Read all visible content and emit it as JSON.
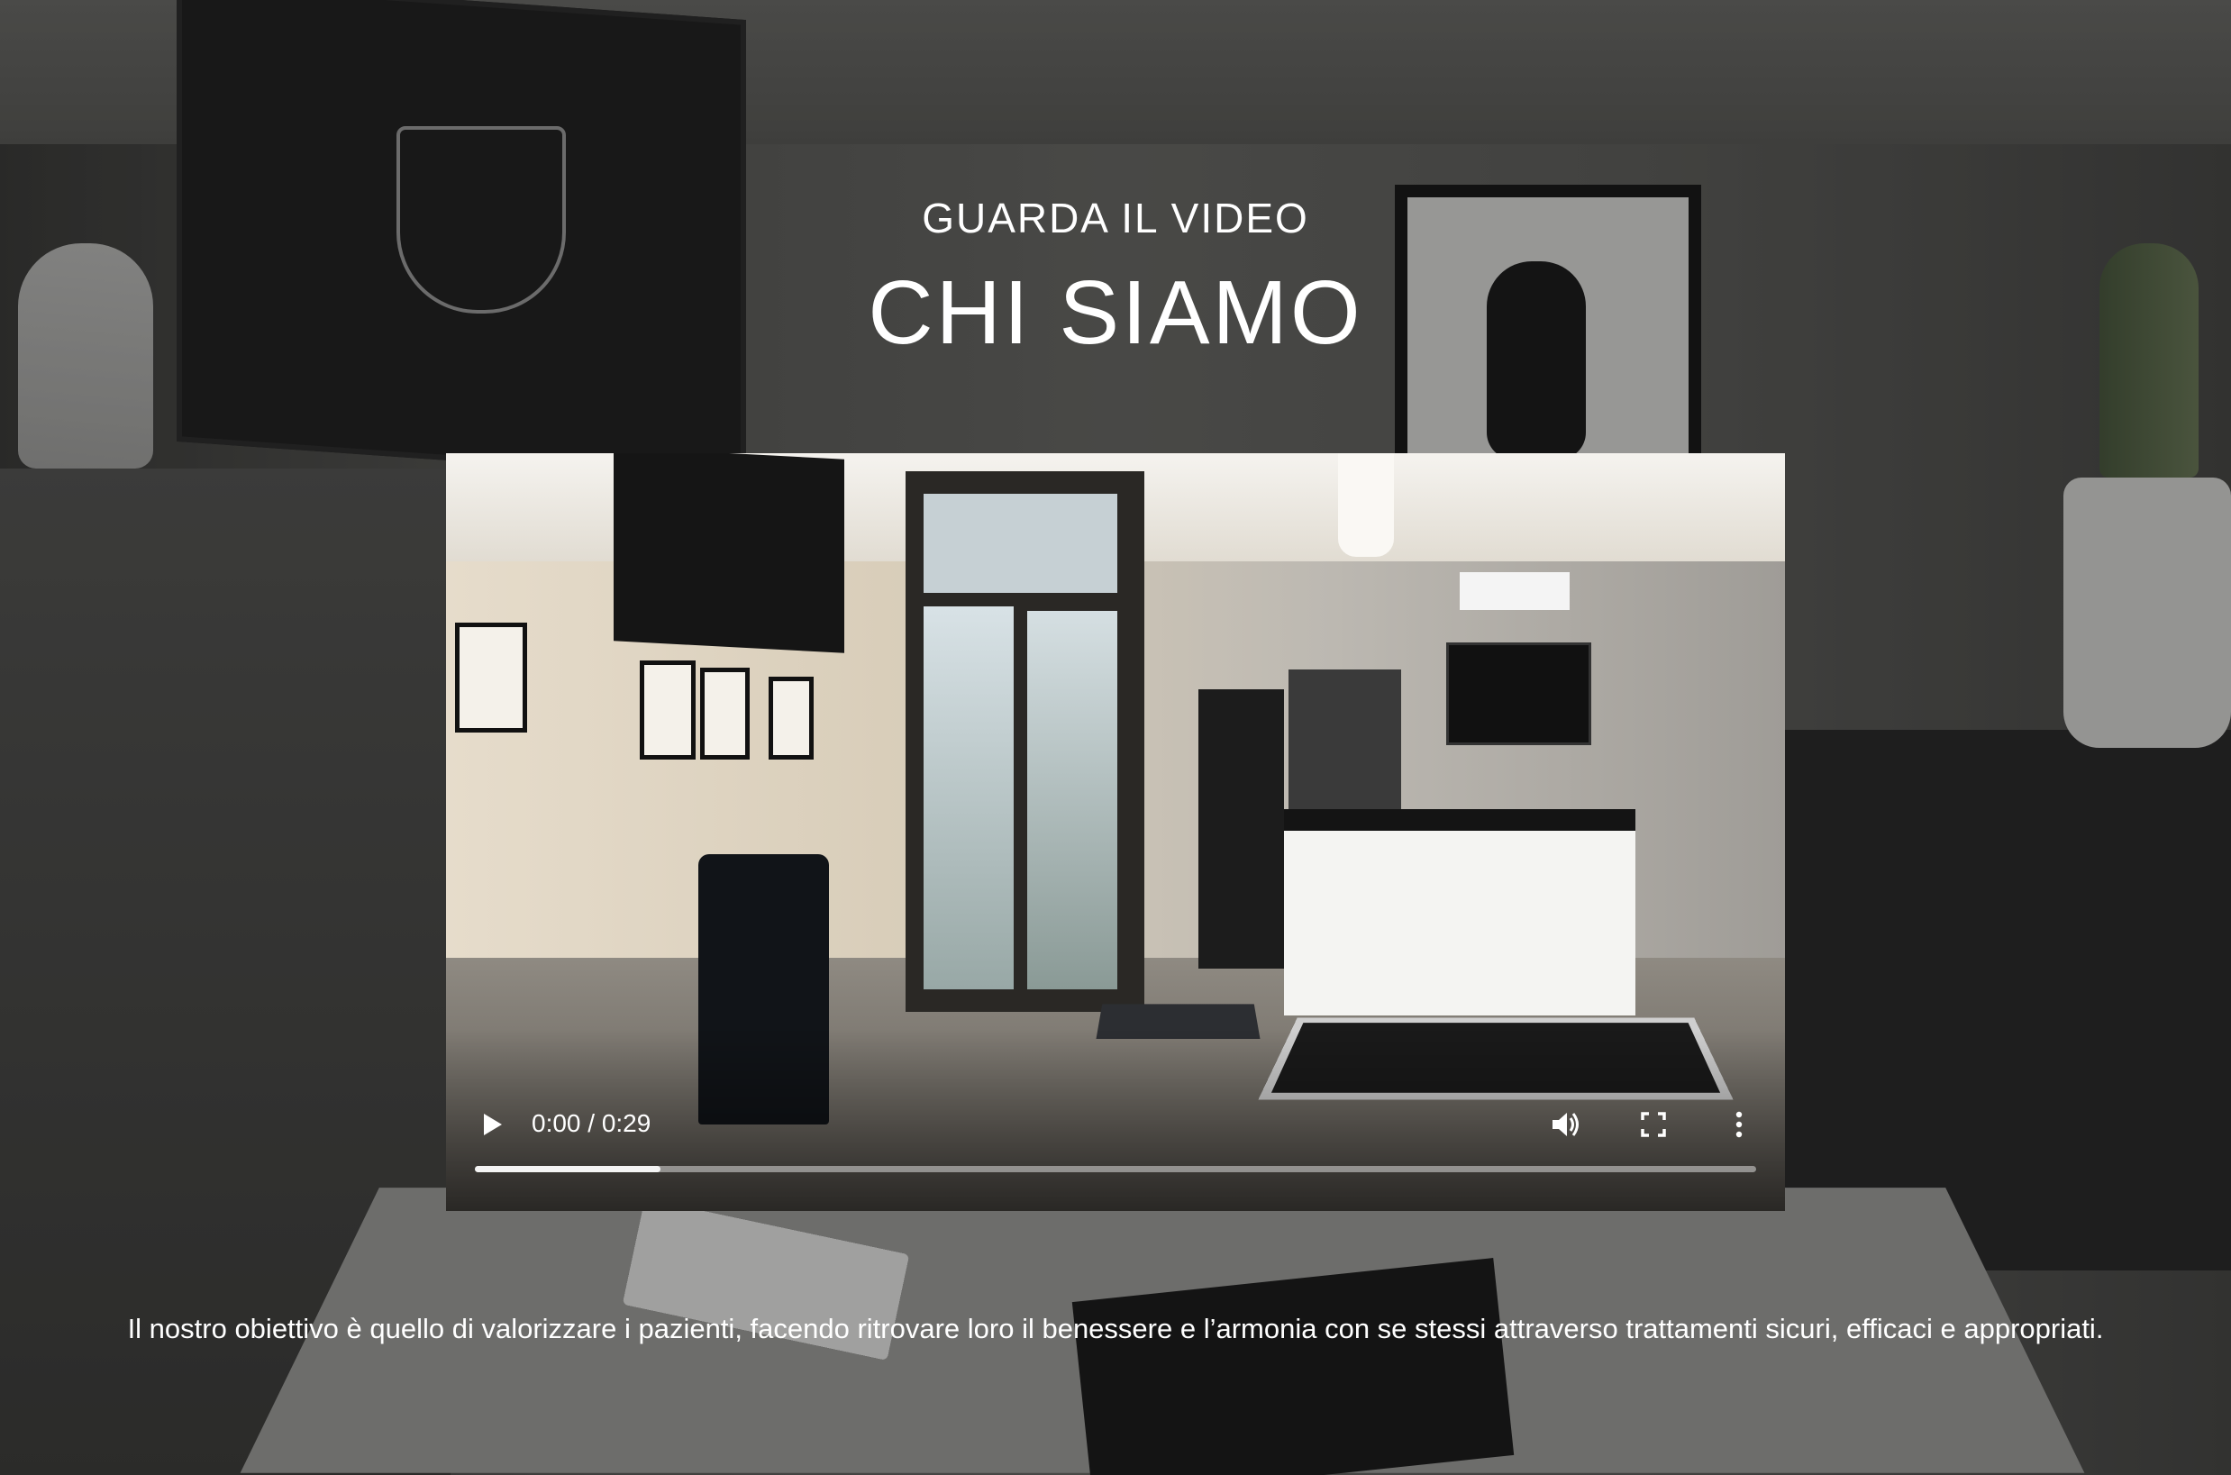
{
  "header": {
    "subtitle": "GUARDA IL VIDEO",
    "title": "CHI SIAMO"
  },
  "video": {
    "time_display": "0:00 / 0:29",
    "current_time": "0:00",
    "duration": "0:29",
    "buffered_fraction": 0.145,
    "icons": {
      "play": "play-icon",
      "volume": "volume-icon",
      "fullscreen": "fullscreen-icon",
      "more": "more-options-icon"
    }
  },
  "description": "Il nostro obiettivo è quello di valorizzare i pazienti, facendo ritrovare loro il benessere e l’armonia con se stessi attraverso trattamenti sicuri, efficaci e appropriati.",
  "colors": {
    "text": "#ffffff",
    "progress_track": "#ffffff73",
    "progress_buffered": "#ffffffe6"
  }
}
